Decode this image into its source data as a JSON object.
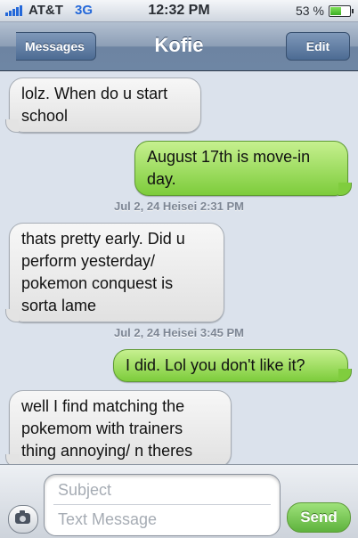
{
  "status_bar": {
    "carrier": "AT&T",
    "network": "3G",
    "time": "12:32 PM",
    "battery": "53 %",
    "battery_level": 0.53,
    "signal_bars": 5
  },
  "nav": {
    "back_label": "Messages",
    "title": "Kofie",
    "edit_label": "Edit"
  },
  "messages": [
    {
      "direction": "incoming",
      "text": "lolz. When do u start school"
    },
    {
      "direction": "outgoing",
      "text": "August 17th is move-in day."
    },
    {
      "timestamp": "Jul 2, 24 Heisei 2:31 PM"
    },
    {
      "direction": "incoming",
      "text": "thats pretty early. Did u perform yesterday/ pokemon conquest is sorta lame"
    },
    {
      "timestamp": "Jul 2, 24 Heisei 3:45 PM"
    },
    {
      "direction": "outgoing",
      "text": "I did. Lol you don't like it?"
    },
    {
      "direction": "incoming",
      "text": "well I find matching the pokemom with trainers thing annoying/ n theres"
    }
  ],
  "compose": {
    "subject_placeholder": "Subject",
    "message_placeholder": "Text Message",
    "send_label": "Send"
  },
  "colors": {
    "outgoing_bubble": "#8fd64b",
    "incoming_bubble": "#ececec",
    "nav_bar": "#7a90ad",
    "accent_blue": "#2468d9"
  }
}
